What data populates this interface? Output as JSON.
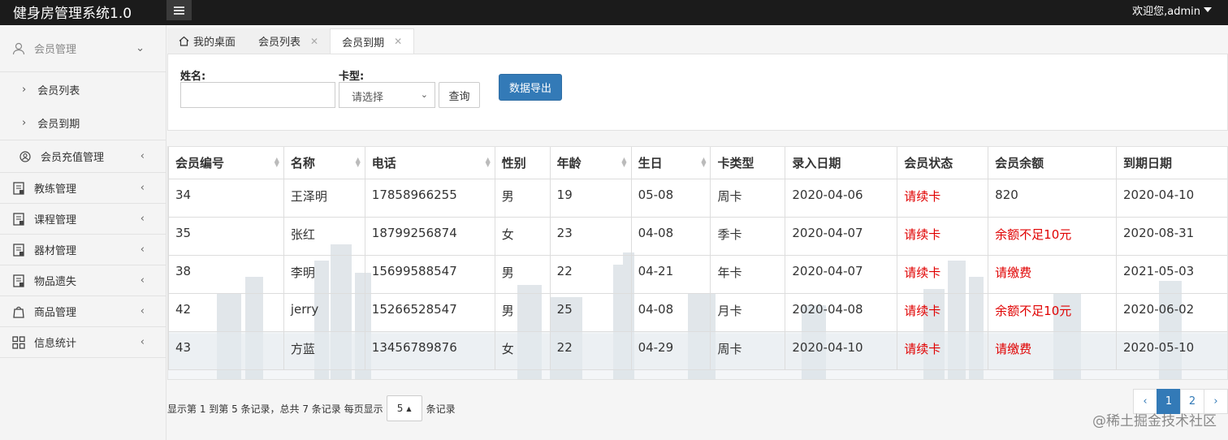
{
  "app": {
    "title": "健身房管理系统1.0",
    "user": "欢迎您,admin"
  },
  "sidebar": {
    "items": [
      {
        "label": "会员管理",
        "sub": [
          "会员列表",
          "会员到期"
        ]
      },
      {
        "label": "会员充值管理"
      },
      {
        "label": "教练管理"
      },
      {
        "label": "课程管理"
      },
      {
        "label": "器材管理"
      },
      {
        "label": "物品遗失"
      },
      {
        "label": "商品管理"
      },
      {
        "label": "信息统计"
      }
    ]
  },
  "tabs": [
    {
      "label": "我的桌面"
    },
    {
      "label": "会员列表"
    },
    {
      "label": "会员到期"
    }
  ],
  "filter": {
    "name_label": "姓名:",
    "card_label": "卡型:",
    "card_select": "请选择",
    "query_button": "查询",
    "export_button": "数据导出"
  },
  "table": {
    "headers": [
      "会员编号",
      "名称",
      "电话",
      "性别",
      "年龄",
      "生日",
      "卡类型",
      "录入日期",
      "会员状态",
      "会员余额",
      "到期日期"
    ],
    "rows": [
      [
        "34",
        "王泽明",
        "17858966255",
        "男",
        "19",
        "05-08",
        "周卡",
        "2020-04-06",
        "请续卡",
        "820",
        "2020-04-10"
      ],
      [
        "35",
        "张红",
        "18799256874",
        "女",
        "23",
        "04-08",
        "季卡",
        "2020-04-07",
        "请续卡",
        "余额不足10元",
        "2020-08-31"
      ],
      [
        "38",
        "李明",
        "15699588547",
        "男",
        "22",
        "04-21",
        "年卡",
        "2020-04-07",
        "请续卡",
        "请缴费",
        "2021-05-03"
      ],
      [
        "42",
        "jerry",
        "15266528547",
        "男",
        "25",
        "04-08",
        "月卡",
        "2020-04-08",
        "请续卡",
        "余额不足10元",
        "2020-06-02"
      ],
      [
        "43",
        "方蓝",
        "13456789876",
        "女",
        "22",
        "04-29",
        "周卡",
        "2020-04-10",
        "请续卡",
        "请缴费",
        "2020-05-10"
      ]
    ]
  },
  "pagination": {
    "info_before": "显示第 1 到第 5 条记录，总共 7 条记录 每页显示",
    "page_size": "5",
    "info_after": "条记录",
    "prev": "‹",
    "pages": [
      "1",
      "2"
    ],
    "next": "›"
  },
  "watermark": "@稀土掘金技术社区"
}
